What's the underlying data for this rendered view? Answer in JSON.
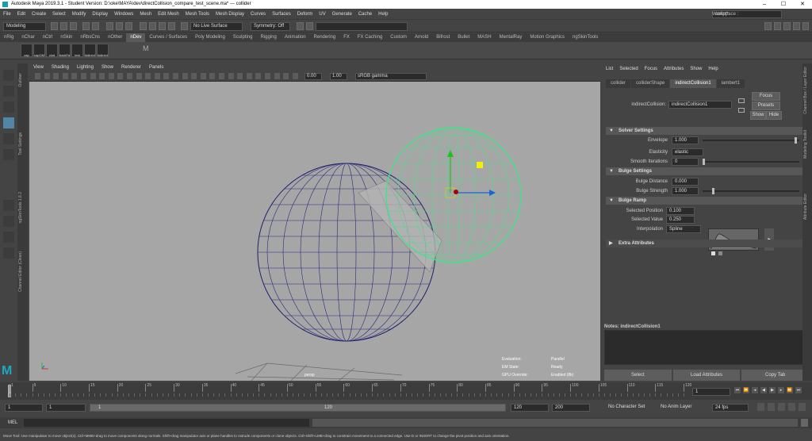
{
  "window": {
    "title": "Autodesk Maya 2019.3.1 - Student Version: D:\\oke\\MAYA\\dev\\directCollision_compare_test_scene.ma* --- collider"
  },
  "menubar": [
    "File",
    "Edit",
    "Create",
    "Select",
    "Modify",
    "Display",
    "Windows",
    "Mesh",
    "Edit Mesh",
    "Mesh Tools",
    "Mesh Display",
    "Curves",
    "Surfaces",
    "Deform",
    "UV",
    "Generate",
    "Cache",
    "Help"
  ],
  "workspace": {
    "label": "Workspace :",
    "value": "script*"
  },
  "statusline": {
    "mode": "Modeling",
    "live": "No Live Surface",
    "symmetry": "Symmetry: Off"
  },
  "shelf_tabs": [
    "nRig",
    "nChar",
    "nCtrl",
    "nSkin",
    "nRbsCns",
    "nOther",
    "nDev",
    "Curves / Surfaces",
    "Poly Modeling",
    "Sculpting",
    "Rigging",
    "Animation",
    "Rendering",
    "FX",
    "FX Caching",
    "Custom",
    "Arnold",
    "Bifrost",
    "Bullet",
    "MASH",
    "MentalRay",
    "Motion Graphics",
    "ngSkinTools"
  ],
  "shelf_active": "nDev",
  "shelf_buttons": [
    "cap",
    "capOM",
    "clod",
    "backFa",
    "test",
    "indirect",
    "indirect"
  ],
  "side_tabs": [
    "Outliner",
    "Tool Settings",
    "ngSkinTools 1.8.2",
    "Channel Editor (Clean)"
  ],
  "viewport_menu": [
    "View",
    "Shading",
    "Lighting",
    "Show",
    "Renderer",
    "Panels"
  ],
  "viewport_fields": {
    "near": "0.00",
    "far": "1.00",
    "colorspace": "sRGB gamma"
  },
  "viewport_label": "persp",
  "hud": [
    {
      "k": "Evaluation:",
      "v": "Parallel"
    },
    {
      "k": "EM State:",
      "v": "Ready"
    },
    {
      "k": "GPU Override:",
      "v": "Enabled (8k)"
    }
  ],
  "attr": {
    "menu": [
      "List",
      "Selected",
      "Focus",
      "Attributes",
      "Show",
      "Help"
    ],
    "tabs": [
      "collider",
      "colliderShape",
      "indirectCollision1",
      "lambert1"
    ],
    "active_tab": "indirectCollision1",
    "node_label": "indirectCollision:",
    "node_value": "indirectCollision1",
    "buttons": {
      "focus": "Focus",
      "presets": "Presets",
      "show": "Show",
      "hide": "Hide"
    },
    "solver": {
      "title": "Solver Settings",
      "envelope_label": "Envelope",
      "envelope": "1.000",
      "elasticity_label": "Elasticity",
      "elasticity": "elastic",
      "smooth_label": "Smooth Iterations",
      "smooth": "0"
    },
    "bulge": {
      "title": "Bulge Settings",
      "distance_label": "Bulge Distance",
      "distance": "0.000",
      "strength_label": "Bulge Strength",
      "strength": "1.000"
    },
    "ramp": {
      "title": "Bulge Ramp",
      "pos_label": "Selected Position",
      "pos": "0.100",
      "val_label": "Selected Value",
      "val": "0.250",
      "interp_label": "Interpolation",
      "interp": "Spline"
    },
    "extra": "Extra Attributes",
    "notes": "Notes: indirectCollision1",
    "bottom_buttons": [
      "Select",
      "Load Attributes",
      "Copy Tab"
    ]
  },
  "right_tabs": [
    "Channel Box / Layer Editor",
    "Modeling Toolkit",
    "Attribute Editor"
  ],
  "timeline": {
    "ticks": [
      "1",
      "5",
      "10",
      "15",
      "20",
      "25",
      "30",
      "35",
      "40",
      "45",
      "50",
      "55",
      "60",
      "65",
      "70",
      "75",
      "80",
      "85",
      "90",
      "95",
      "100",
      "105",
      "110",
      "115",
      "120"
    ],
    "current": "1"
  },
  "range": {
    "start": "1",
    "inner_start": "1",
    "inner_start2": "1",
    "inner_end": "120",
    "end": "120",
    "outer_end": "200",
    "character": "No Character Set",
    "anim_layer": "No Anim Layer",
    "fps": "24 fps"
  },
  "cmd": {
    "label": "MEL"
  },
  "help": "Move Tool: Use manipulator to move object(s). Ctrl+MMB+drag to move components along normals. Shift+drag manipulator axis or plane handles to extrude components or clone objects. Ctrl+Shift+LMB+drag to constrain movement to a connected edge. Use D or INSERT to change the pivot position and axis orientation.",
  "colors": {
    "accent": "#5285a6",
    "collider_wire": "#45e08a",
    "mesh_wire": "#1f1f6b",
    "viewport_bg": "#a6a6a6"
  }
}
